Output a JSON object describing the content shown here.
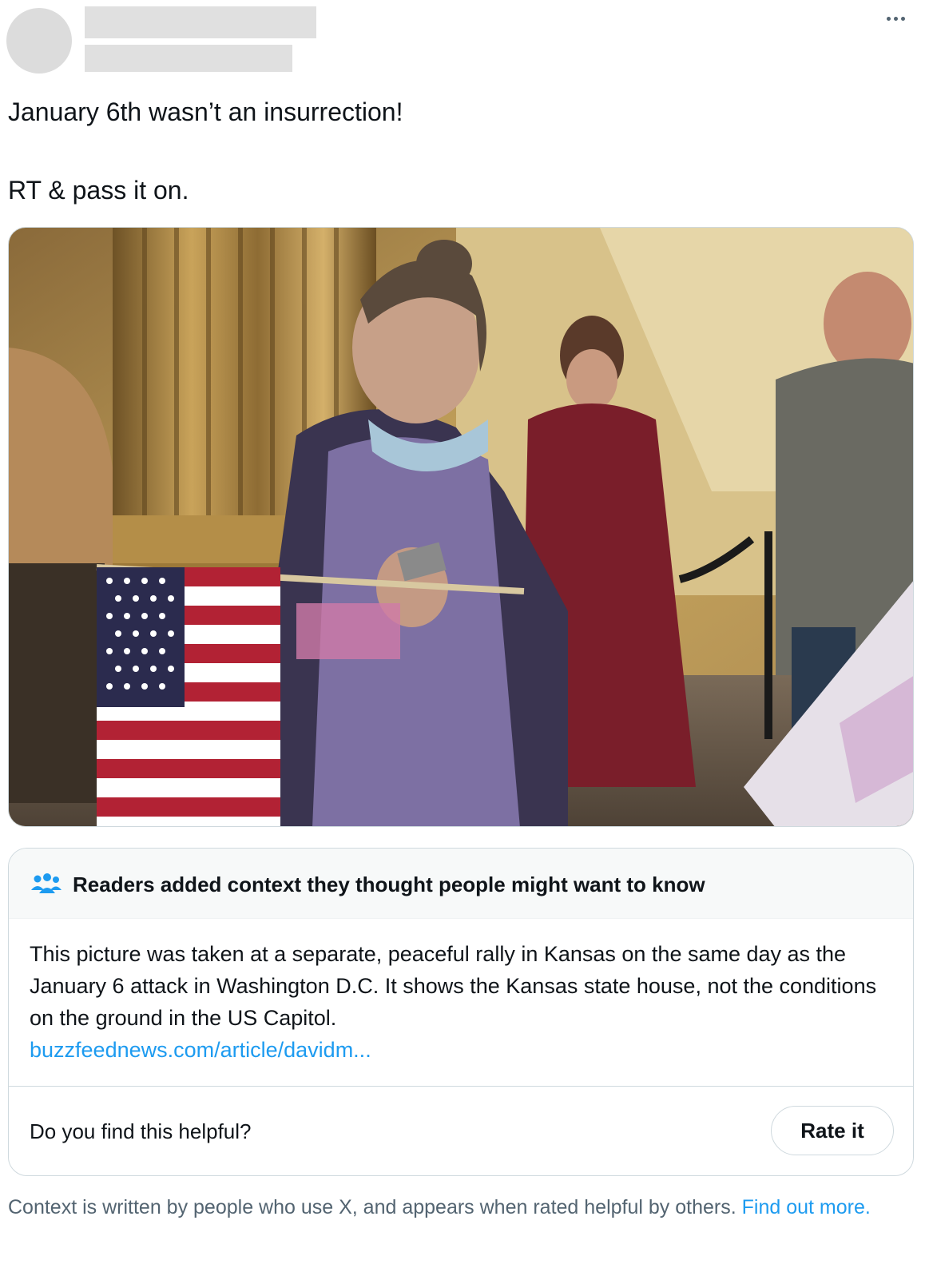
{
  "tweet": {
    "line1": "January 6th wasn’t an insurrection!",
    "line2": "RT & pass it on."
  },
  "media": {
    "icon": "photo-image"
  },
  "note": {
    "heading": "Readers added context they thought people might want to know",
    "body": "This picture was taken at a separate, peaceful rally in Kansas on the same day as the January 6 attack in Washington D.C. It shows the Kansas state house, not the conditions on the ground in the US Capitol.",
    "link": "buzzfeednews.com/article/davidm...",
    "helpful_question": "Do you find this helpful?",
    "rate_label": "Rate it"
  },
  "footer": {
    "text": "Context is written by people who use X, and appears when rated helpful by others.",
    "link": "Find out more."
  },
  "colors": {
    "link": "#1d9bf0",
    "secondary_text": "#536471",
    "border": "#cfd9de"
  }
}
